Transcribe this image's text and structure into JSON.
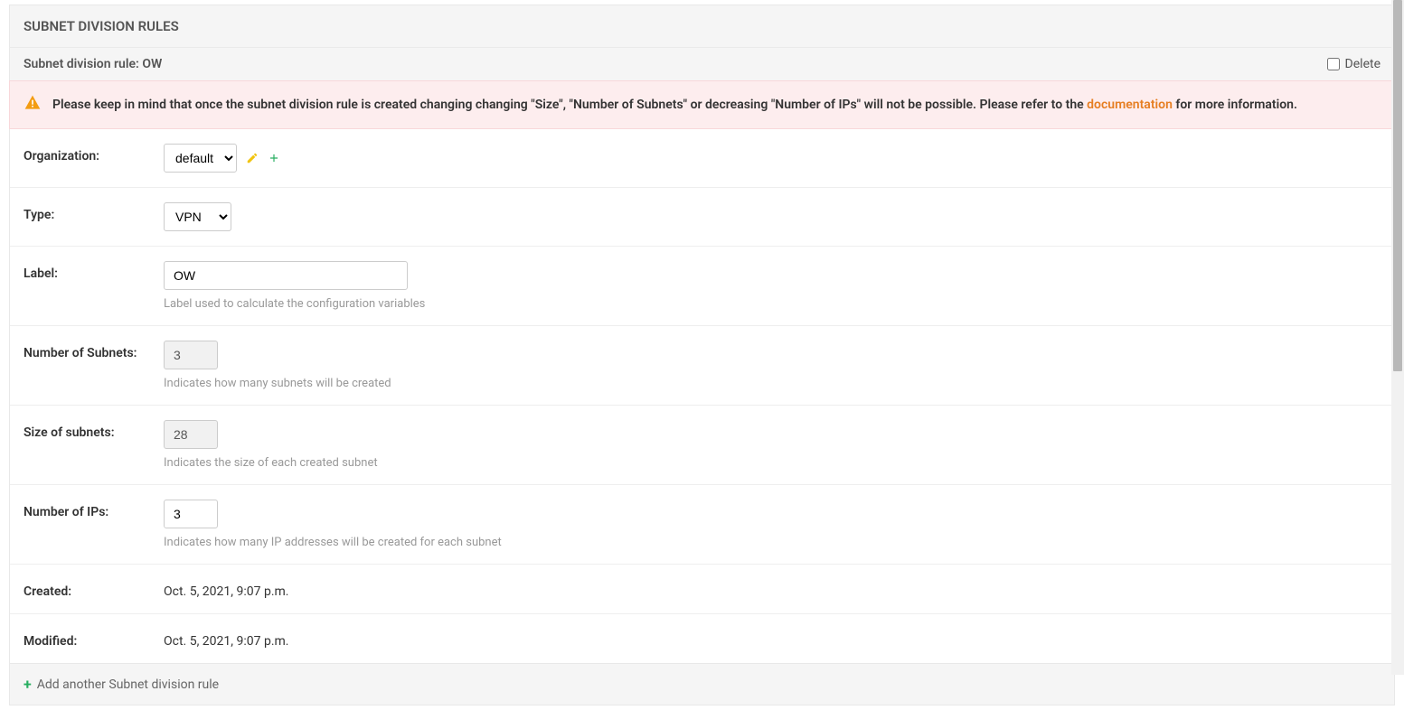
{
  "section": {
    "title": "SUBNET DIVISION RULES",
    "subtitle_prefix": "Subnet division rule: ",
    "subtitle_name": "OW",
    "delete_label": "Delete"
  },
  "alert": {
    "text_before_link": "Please keep in mind that once the subnet division rule is created changing changing \"Size\", \"Number of Subnets\" or decreasing \"Number of IPs\" will not be possible. Please refer to the ",
    "link_text": "documentation",
    "text_after_link": " for more information."
  },
  "form": {
    "organization": {
      "label": "Organization:",
      "value": "default"
    },
    "type": {
      "label": "Type:",
      "value": "VPN"
    },
    "rule_label": {
      "label": "Label:",
      "value": "OW",
      "help": "Label used to calculate the configuration variables"
    },
    "num_subnets": {
      "label": "Number of Subnets:",
      "value": "3",
      "help": "Indicates how many subnets will be created"
    },
    "size_subnets": {
      "label": "Size of subnets:",
      "value": "28",
      "help": "Indicates the size of each created subnet"
    },
    "num_ips": {
      "label": "Number of IPs:",
      "value": "3",
      "help": "Indicates how many IP addresses will be created for each subnet"
    },
    "created": {
      "label": "Created:",
      "value": "Oct. 5, 2021, 9:07 p.m."
    },
    "modified": {
      "label": "Modified:",
      "value": "Oct. 5, 2021, 9:07 p.m."
    }
  },
  "add_another": {
    "label": "Add another Subnet division rule"
  }
}
